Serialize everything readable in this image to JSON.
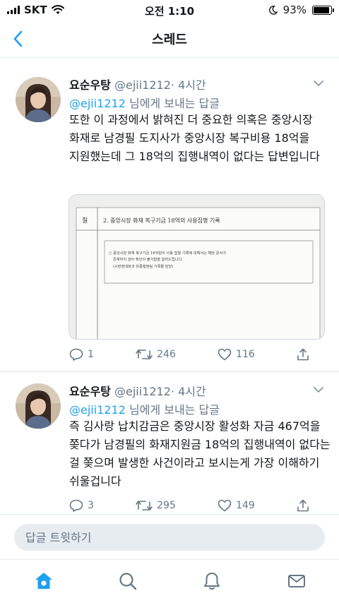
{
  "status_bar": {
    "carrier": "SKT",
    "time": "오전 1:10",
    "battery": "93%",
    "battery_level": 0.93
  },
  "nav": {
    "title": "스레드"
  },
  "tweets": [
    {
      "name": "요순우탕",
      "handle": "@ejii1212",
      "time": "· 4시간",
      "reply_to_mention": "@ejii1212",
      "reply_to_suffix": " 님에게 보내는 답글",
      "text": "또한 이 과정에서 밝혀진 더 중요한 의혹은 중앙시장 화재로 남경필 도지사가 중앙시장 복구비용 18억을 지원했는데 그 18억의 집행내역이 없다는 답변입니다",
      "replies": "1",
      "retweets": "246",
      "likes": "116",
      "media": {
        "row_label": "질",
        "header": "2. 중앙시장 화재 복구기금 18억의 사용집행 기록",
        "body_line1": "○ 중앙시장 화재 복구기금 18억원의 사용 집행 기록에 대해서는 해당 문서가",
        "body_line2": "존재하지 않아 확인이 불가함을 알려드립니다.",
        "body_line3": "(시장현대화과 유통행정팀 기록물 담당)"
      }
    },
    {
      "name": "요순우탕",
      "handle": "@ejii1212",
      "time": "· 4시간",
      "reply_to_mention": "@ejii1212",
      "reply_to_suffix": " 님에게 보내는 답글",
      "text": "즉 김사랑 납치감금은 중앙시장 활성화 자금 467억을 쫒다가 남경필의 화재지원금 18억의 집행내역이 없다는 걸 쫒으며 발생한 사건이라고 보시는게 가장 이해하기 쉬울겁니다",
      "replies": "3",
      "retweets": "295",
      "likes": "149"
    }
  ],
  "reply_bar": {
    "placeholder": "답글 트윗하기"
  },
  "tab_bar": {
    "active_color": "#1da1f2",
    "inactive_color": "#657786"
  }
}
